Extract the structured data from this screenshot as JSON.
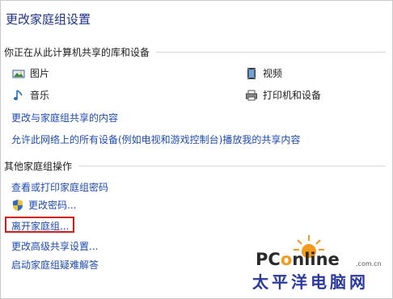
{
  "page": {
    "title": "更改家庭组设置"
  },
  "shared_section": {
    "heading": "你正在从此计算机共享的库和设备",
    "items": [
      {
        "label": "图片",
        "icon": "pictures-icon"
      },
      {
        "label": "视频",
        "icon": "videos-icon"
      },
      {
        "label": "音乐",
        "icon": "music-icon"
      },
      {
        "label": "打印机和设备",
        "icon": "printer-icon"
      }
    ],
    "links": {
      "change_shared": "更改与家庭组共享的内容",
      "allow_devices": "允许此网络上的所有设备(例如电视和游戏控制台)播放我的共享内容"
    }
  },
  "other_section": {
    "heading": "其他家庭组操作",
    "links": {
      "view_print_password": "查看或打印家庭组密码",
      "change_password": "更改密码...",
      "leave_homegroup": "离开家庭组...",
      "advanced_sharing": "更改高级共享设置...",
      "troubleshooter": "启动家庭组疑难解答"
    }
  },
  "watermark": {
    "brand_pc": "PC",
    "brand_o": "o",
    "brand_rest": "nline",
    "domain": ".com.cn",
    "cn_name": "太平洋电脑网"
  },
  "colors": {
    "link": "#1e4bb3",
    "title": "#1e3287",
    "highlight": "#d21b1b",
    "brand_orange": "#f29a1e"
  }
}
